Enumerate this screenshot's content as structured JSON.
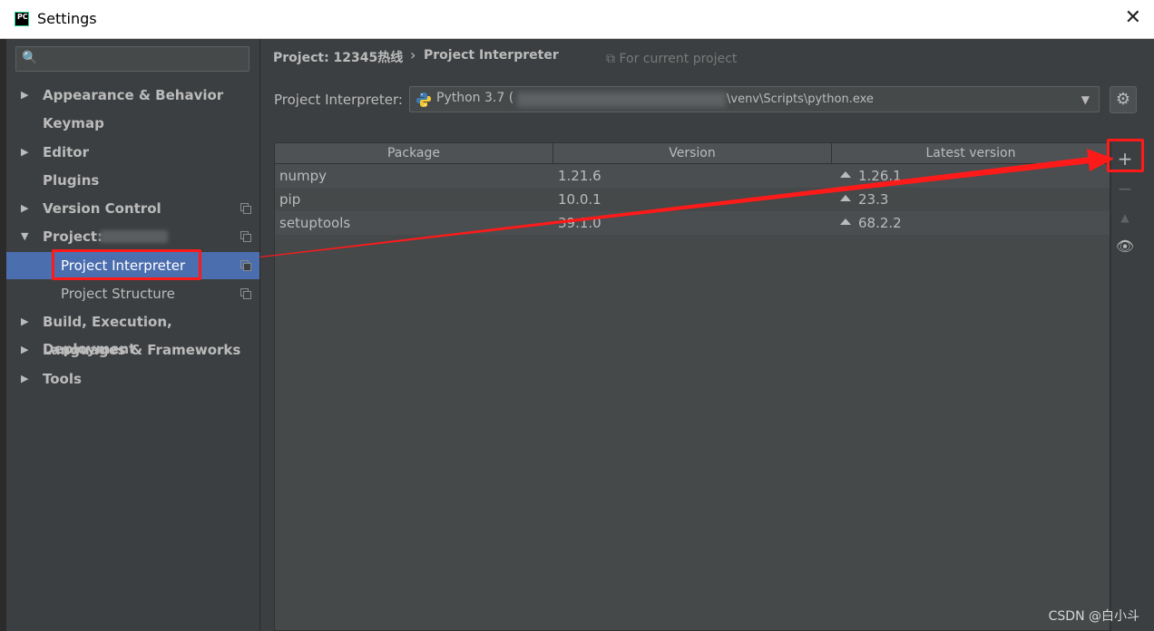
{
  "window": {
    "title": "Settings",
    "app_icon_text": "PC",
    "close_glyph": "✕"
  },
  "sidebar": {
    "search_placeholder": "",
    "search_icon": "🔍",
    "items": [
      {
        "label": "Appearance & Behavior",
        "arrow": "▶"
      },
      {
        "label": "Keymap",
        "arrow": ""
      },
      {
        "label": "Editor",
        "arrow": "▶"
      },
      {
        "label": "Plugins",
        "arrow": ""
      },
      {
        "label": "Version Control",
        "arrow": "▶"
      },
      {
        "label": "Project:",
        "arrow": "▼"
      },
      {
        "label": "Project Interpreter",
        "arrow": ""
      },
      {
        "label": "Project Structure",
        "arrow": ""
      },
      {
        "label": "Build, Execution, Deployment",
        "arrow": "▶"
      },
      {
        "label": "Languages & Frameworks",
        "arrow": "▶"
      },
      {
        "label": "Tools",
        "arrow": "▶"
      }
    ]
  },
  "main": {
    "breadcrumb_project": "Project: 12345热线",
    "breadcrumb_sep": "›",
    "breadcrumb_page": "Project Interpreter",
    "for_current_project": "⧉ For current project",
    "interpreter_label": "Project Interpreter:",
    "interpreter_name": "Python 3.7 (",
    "interpreter_path": "\\venv\\Scripts\\python.exe",
    "combo_arrow": "▼",
    "gear_glyph": "⚙"
  },
  "packages": {
    "columns": [
      "Package",
      "Version",
      "Latest version"
    ],
    "rows": [
      {
        "name": "numpy",
        "version": "1.21.6",
        "latest": "1.26.1"
      },
      {
        "name": "pip",
        "version": "10.0.1",
        "latest": "23.3"
      },
      {
        "name": "setuptools",
        "version": "39.1.0",
        "latest": "68.2.2"
      }
    ]
  },
  "toolbar": {
    "add": "+",
    "remove": "−",
    "upgrade": "▲",
    "show_early": "👁"
  },
  "annotation_color": "#ff1a1a",
  "watermark": "CSDN @白小斗"
}
